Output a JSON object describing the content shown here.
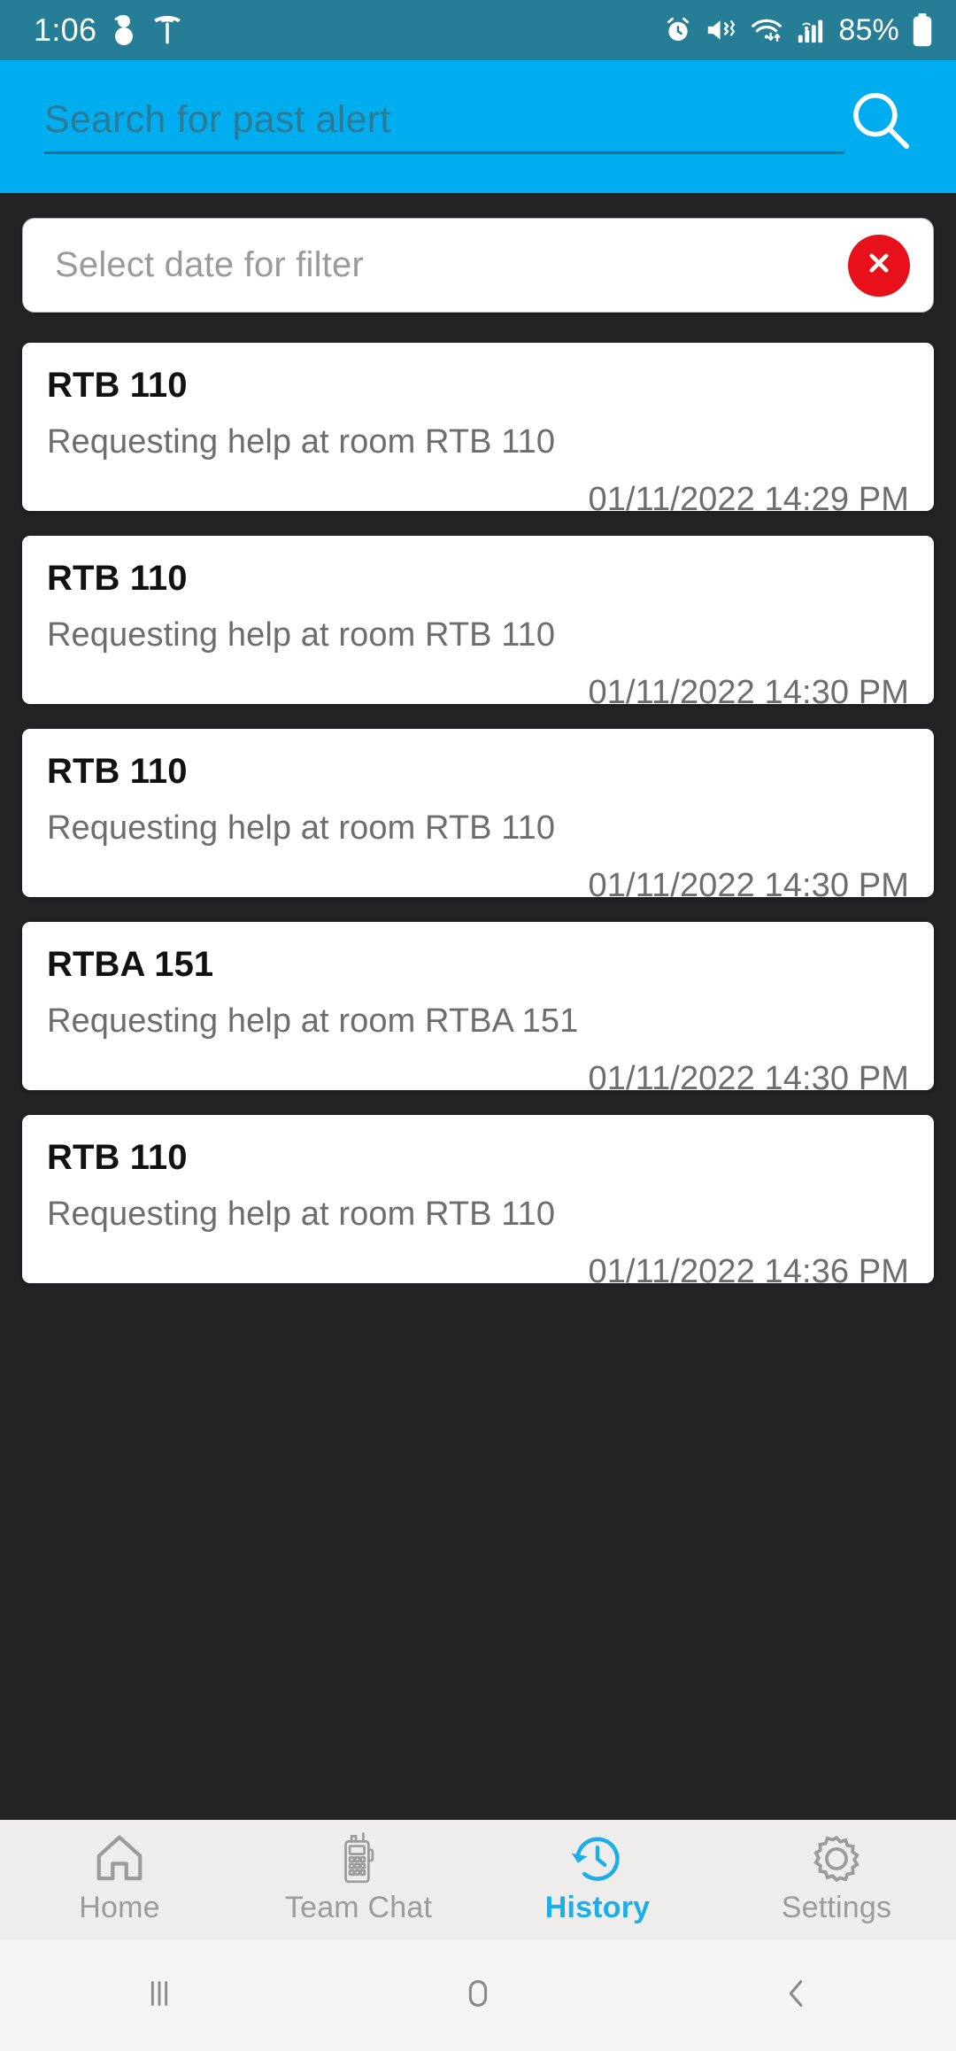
{
  "status_bar": {
    "time": "1:06",
    "battery_percent": "85%",
    "left_icons": [
      "snowman-icon",
      "tesla-icon"
    ],
    "right_icons": [
      "alarm-icon",
      "mute-vibrate-icon",
      "wifi-icon",
      "cellular-signal-icon",
      "battery-icon"
    ],
    "background_color": "#267D96"
  },
  "search": {
    "placeholder": "Search for past alert",
    "icon": "search-icon",
    "background_color": "#00AEEF"
  },
  "date_filter": {
    "placeholder": "Select date for filter",
    "clear_icon": "close-circle-icon",
    "clear_color": "#E8101A"
  },
  "alerts": [
    {
      "title": "RTB 110",
      "message": "Requesting help at room RTB 110",
      "timestamp": "01/11/2022 14:29 PM"
    },
    {
      "title": "RTB 110",
      "message": "Requesting help at room RTB 110",
      "timestamp": "01/11/2022 14:30 PM"
    },
    {
      "title": "RTB 110",
      "message": "Requesting help at room RTB 110",
      "timestamp": "01/11/2022 14:30 PM"
    },
    {
      "title": "RTBA 151",
      "message": "Requesting help at room RTBA 151",
      "timestamp": "01/11/2022 14:30 PM"
    },
    {
      "title": "RTB 110",
      "message": "Requesting help at room RTB 110",
      "timestamp": "01/11/2022 14:36 PM"
    }
  ],
  "tabs": [
    {
      "label": "Home",
      "icon": "home-icon",
      "active": false
    },
    {
      "label": "Team Chat",
      "icon": "walkie-talkie-icon",
      "active": false
    },
    {
      "label": "History",
      "icon": "history-clock-icon",
      "active": true
    },
    {
      "label": "Settings",
      "icon": "gear-icon",
      "active": false
    }
  ],
  "active_tab_color": "#1AAFEA",
  "android_nav": {
    "recents": "recents-icon",
    "home": "home-pill-icon",
    "back": "back-chevron-icon"
  }
}
